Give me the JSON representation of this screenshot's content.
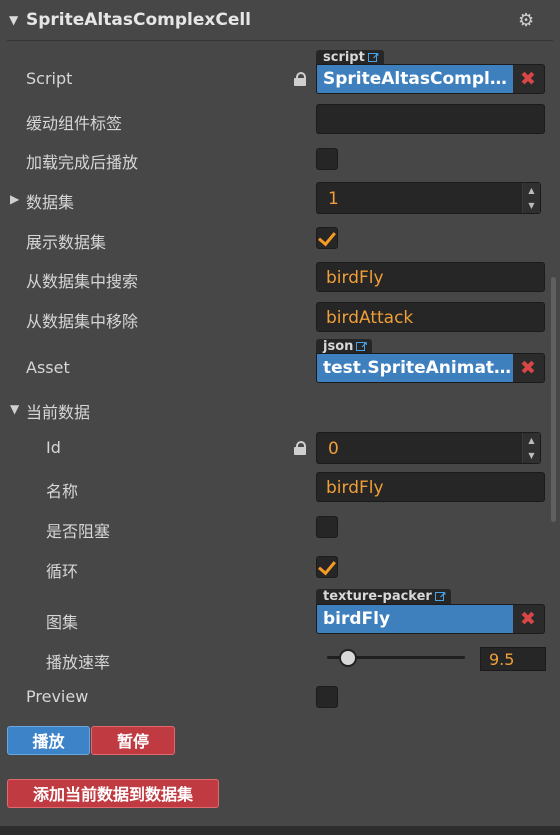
{
  "component": {
    "title": "SpriteAltasComplexCell",
    "fold_icon": "triangle-down",
    "settings_icon": "gear-icon"
  },
  "props": {
    "script": {
      "label": "Script",
      "tag": "script",
      "value": "SpriteAltasComplex…"
    },
    "easing_label": {
      "label": "缓动组件标签",
      "value": ""
    },
    "play_on_load": {
      "label": "加载完成后播放",
      "checked": false
    },
    "dataset": {
      "label": "数据集",
      "value": "1"
    },
    "show_dataset": {
      "label": "展示数据集",
      "checked": true
    },
    "search_dataset": {
      "label": "从数据集中搜索",
      "value": "birdFly"
    },
    "remove_dataset": {
      "label": "从数据集中移除",
      "value": "birdAttack"
    },
    "asset": {
      "label": "Asset",
      "tag": "json",
      "value": "test.SpriteAnimatio…"
    },
    "current": {
      "label": "当前数据",
      "id": {
        "label": "Id",
        "value": "0"
      },
      "name": {
        "label": "名称",
        "value": "birdFly"
      },
      "blocking": {
        "label": "是否阻塞",
        "checked": false
      },
      "loop": {
        "label": "循环",
        "checked": true
      },
      "atlas": {
        "label": "图集",
        "tag": "texture-packer",
        "value": "birdFly"
      },
      "speed": {
        "label": "播放速率",
        "value": "9.5",
        "fraction": 0.1
      }
    },
    "preview": {
      "label": "Preview",
      "checked": false
    }
  },
  "buttons": {
    "play": "播放",
    "pause": "暂停",
    "add_current": "添加当前数据到数据集"
  },
  "colors": {
    "value_orange": "#f09f38",
    "asset_blue": "#3e7fbd",
    "button_blue": "#3c83c8",
    "button_red": "#c03b41",
    "checkmark": "#f59a24"
  }
}
